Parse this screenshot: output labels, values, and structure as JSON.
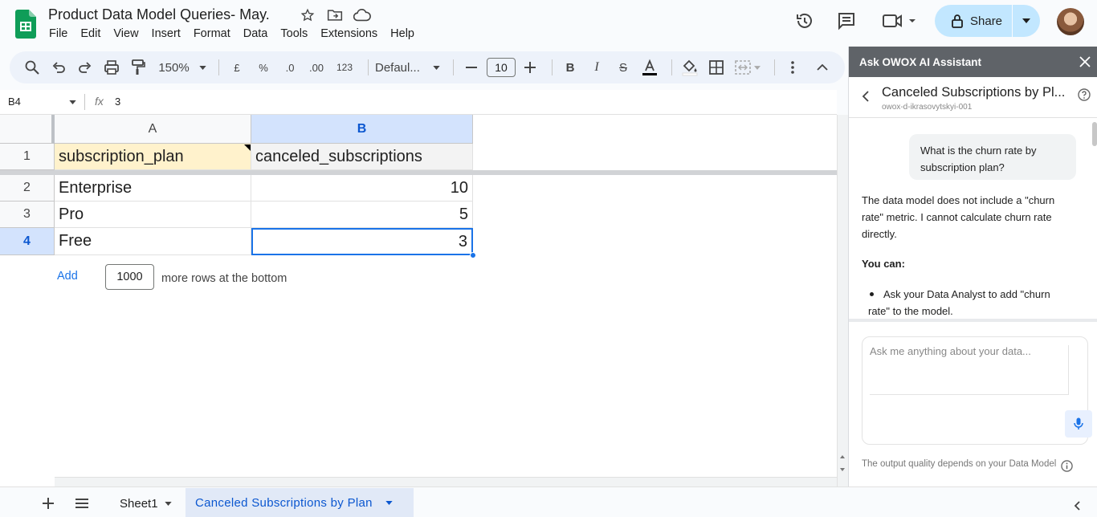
{
  "document": {
    "title": "Product Data Model Queries- May."
  },
  "menu": [
    "File",
    "Edit",
    "View",
    "Insert",
    "Format",
    "Data",
    "Tools",
    "Extensions",
    "Help"
  ],
  "header": {
    "share_label": "Share"
  },
  "toolbar": {
    "zoom": "150%",
    "currency": "£",
    "percent": "%",
    "dec_decrease": ".0",
    "dec_increase": ".00",
    "number_format": "123",
    "font": "Defaul...",
    "font_size": "10"
  },
  "formula_bar": {
    "cell_ref": "B4",
    "fx": "fx",
    "value": "3"
  },
  "sheet": {
    "columns": [
      "A",
      "B"
    ],
    "rows": [
      {
        "num": "1",
        "a": "subscription_plan",
        "b": "canceled_subscriptions"
      },
      {
        "num": "2",
        "a": "Enterprise",
        "b": "10"
      },
      {
        "num": "3",
        "a": "Pro",
        "b": "5"
      },
      {
        "num": "4",
        "a": "Free",
        "b": "3"
      }
    ],
    "add_label": "Add",
    "add_rows_value": "1000",
    "add_rows_text": "more rows at the bottom"
  },
  "tabs": {
    "sheet1": "Sheet1",
    "active": "Canceled Subscriptions by Plan"
  },
  "assistant": {
    "header": "Ask OWOX AI Assistant",
    "chat_title": "Canceled Subscriptions by Pl...",
    "chat_subtitle": "owox-d-ikrasovytskyi-001",
    "user_message": "What is the churn rate by subscription plan?",
    "reply_1": "The data model does not include a \"churn rate\" metric. I cannot calculate churn rate directly.",
    "reply_2": "You can:",
    "reply_bullet": "Ask your Data Analyst to add \"churn rate\" to the model.",
    "input_placeholder": "Ask me anything about your data...",
    "footer": "The output quality depends on your Data Model"
  },
  "colors": {
    "header_cell_yellow": "#fff2cc",
    "selection_blue": "#1a73e8",
    "share_bg": "#c2e7ff",
    "active_tab_text": "#0b57d0"
  }
}
